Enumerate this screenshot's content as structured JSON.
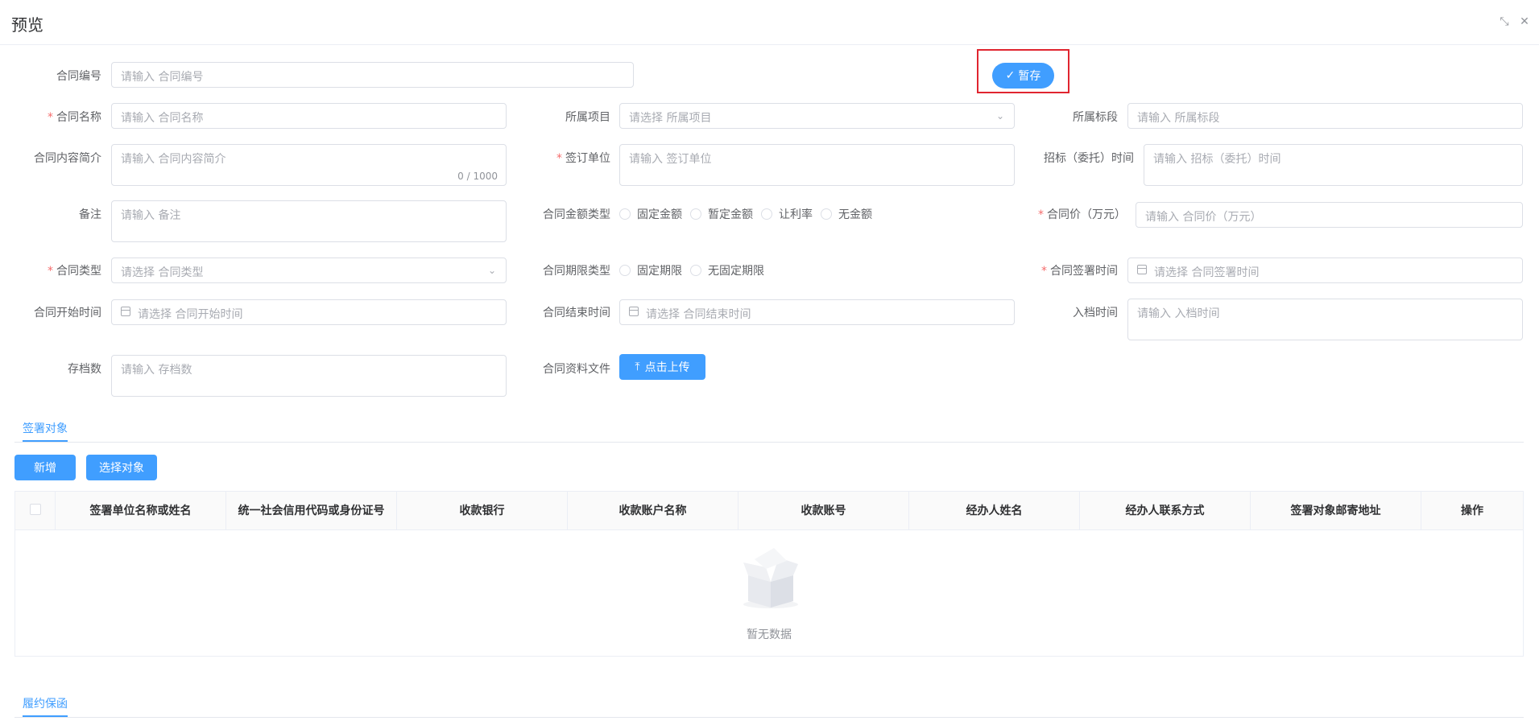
{
  "dialog": {
    "title": "预览"
  },
  "toolbar": {
    "save_label": "暂存"
  },
  "form": {
    "contract_no": {
      "label": "合同编号",
      "placeholder": "请输入 合同编号"
    },
    "contract_name": {
      "label": "合同名称",
      "placeholder": "请输入 合同名称",
      "required": "*"
    },
    "project": {
      "label": "所属项目",
      "placeholder": "请选择 所属项目"
    },
    "section": {
      "label": "所属标段",
      "placeholder": "请输入 所属标段"
    },
    "summary": {
      "label": "合同内容简介",
      "placeholder": "请输入 合同内容简介",
      "counter": "0 / 1000"
    },
    "signing_unit": {
      "label": "签订单位",
      "placeholder": "请输入 签订单位",
      "required": "*"
    },
    "bid_time": {
      "label": "招标（委托）时间",
      "placeholder": "请输入 招标（委托）时间"
    },
    "remark": {
      "label": "备注",
      "placeholder": "请输入 备注"
    },
    "amount_type": {
      "label": "合同金额类型",
      "options": [
        "固定金额",
        "暂定金额",
        "让利率",
        "无金额"
      ]
    },
    "contract_price": {
      "label": "合同价（万元）",
      "placeholder": "请输入 合同价（万元）",
      "required": "*"
    },
    "contract_type": {
      "label": "合同类型",
      "placeholder": "请选择 合同类型",
      "required": "*"
    },
    "term_type": {
      "label": "合同期限类型",
      "options": [
        "固定期限",
        "无固定期限"
      ]
    },
    "sign_time": {
      "label": "合同签署时间",
      "placeholder": "请选择 合同签署时间",
      "required": "*"
    },
    "start_time": {
      "label": "合同开始时间",
      "placeholder": "请选择 合同开始时间"
    },
    "end_time": {
      "label": "合同结束时间",
      "placeholder": "请选择 合同结束时间"
    },
    "archive_time": {
      "label": "入档时间",
      "placeholder": "请输入 入档时间"
    },
    "archive_count": {
      "label": "存档数",
      "placeholder": "请输入 存档数"
    },
    "files": {
      "label": "合同资料文件",
      "upload_label": "点击上传"
    }
  },
  "signing_section": {
    "tab": "签署对象",
    "add_label": "新增",
    "select_label": "选择对象",
    "columns": [
      "签署单位名称或姓名",
      "统一社会信用代码或身份证号",
      "收款银行",
      "收款账户名称",
      "收款账号",
      "经办人姓名",
      "经办人联系方式",
      "签署对象邮寄地址",
      "操作"
    ],
    "empty_text": "暂无数据"
  },
  "guarantee_section": {
    "tab": "履约保函"
  }
}
